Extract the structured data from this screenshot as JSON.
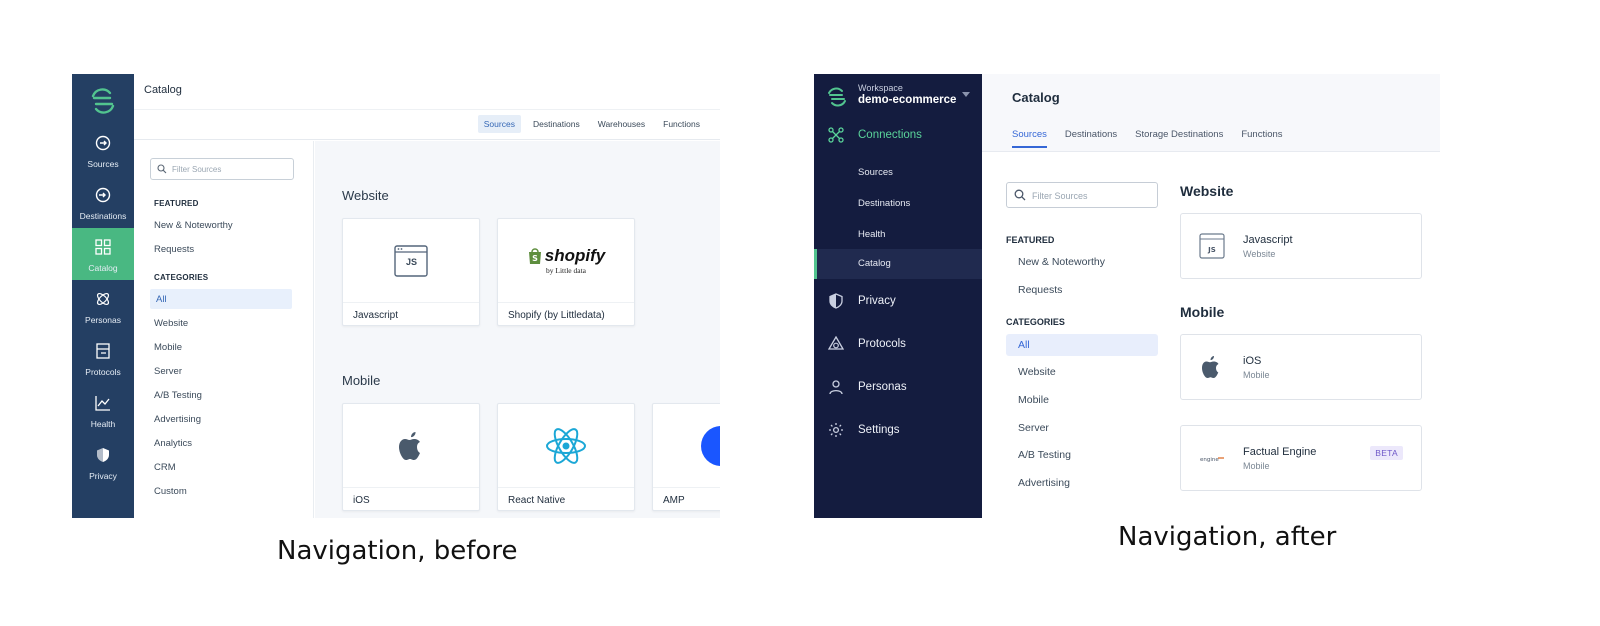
{
  "before": {
    "caption": "Navigation, before",
    "rail": [
      {
        "label": "Sources",
        "icon": "sources-icon"
      },
      {
        "label": "Destinations",
        "icon": "destinations-icon"
      },
      {
        "label": "Catalog",
        "icon": "catalog-icon",
        "active": true
      },
      {
        "label": "Personas",
        "icon": "personas-icon"
      },
      {
        "label": "Protocols",
        "icon": "protocols-icon"
      },
      {
        "label": "Health",
        "icon": "health-icon"
      },
      {
        "label": "Privacy",
        "icon": "privacy-icon"
      }
    ],
    "title": "Catalog",
    "tabs": [
      "Sources",
      "Destinations",
      "Warehouses",
      "Functions"
    ],
    "search_placeholder": "Filter Sources",
    "featured_heading": "FEATURED",
    "featured": [
      "New & Noteworthy",
      "Requests"
    ],
    "categories_heading": "CATEGORIES",
    "categories": [
      "All",
      "Website",
      "Mobile",
      "Server",
      "A/B Testing",
      "Advertising",
      "Analytics",
      "CRM",
      "Custom"
    ],
    "website_heading": "Website",
    "website_cards": [
      "Javascript",
      "Shopify (by Littledata)"
    ],
    "mobile_heading": "Mobile",
    "mobile_cards": [
      "iOS",
      "React Native",
      "AMP"
    ],
    "shopify_word": "shopify",
    "shopify_sub": "by Little data",
    "js_glyph": "JS",
    "accent": "#49b882",
    "rail_color": "#243f63"
  },
  "after": {
    "caption": "Navigation, after",
    "workspace_label": "Workspace",
    "workspace_name": "demo-ecommerce",
    "connections": "Connections",
    "subnav": [
      "Sources",
      "Destinations",
      "Health",
      "Catalog"
    ],
    "nav": [
      "Privacy",
      "Protocols",
      "Personas",
      "Settings"
    ],
    "title": "Catalog",
    "tabs": [
      "Sources",
      "Destinations",
      "Storage Destinations",
      "Functions"
    ],
    "search_placeholder": "Filter Sources",
    "featured_heading": "FEATURED",
    "featured": [
      "New & Noteworthy",
      "Requests"
    ],
    "categories_heading": "CATEGORIES",
    "categories": [
      "All",
      "Website",
      "Mobile",
      "Server",
      "A/B Testing",
      "Advertising"
    ],
    "website_heading": "Website",
    "mobile_heading": "Mobile",
    "cards": [
      {
        "name": "Javascript",
        "sub": "Website"
      },
      {
        "name": "iOS",
        "sub": "Mobile"
      },
      {
        "name": "Factual Engine",
        "sub": "Mobile",
        "badge": "BETA"
      }
    ],
    "js_glyph": "JS",
    "engine_logo_text": "engine",
    "sidebar_color": "#141c3f",
    "accent": "#5ad39a"
  }
}
